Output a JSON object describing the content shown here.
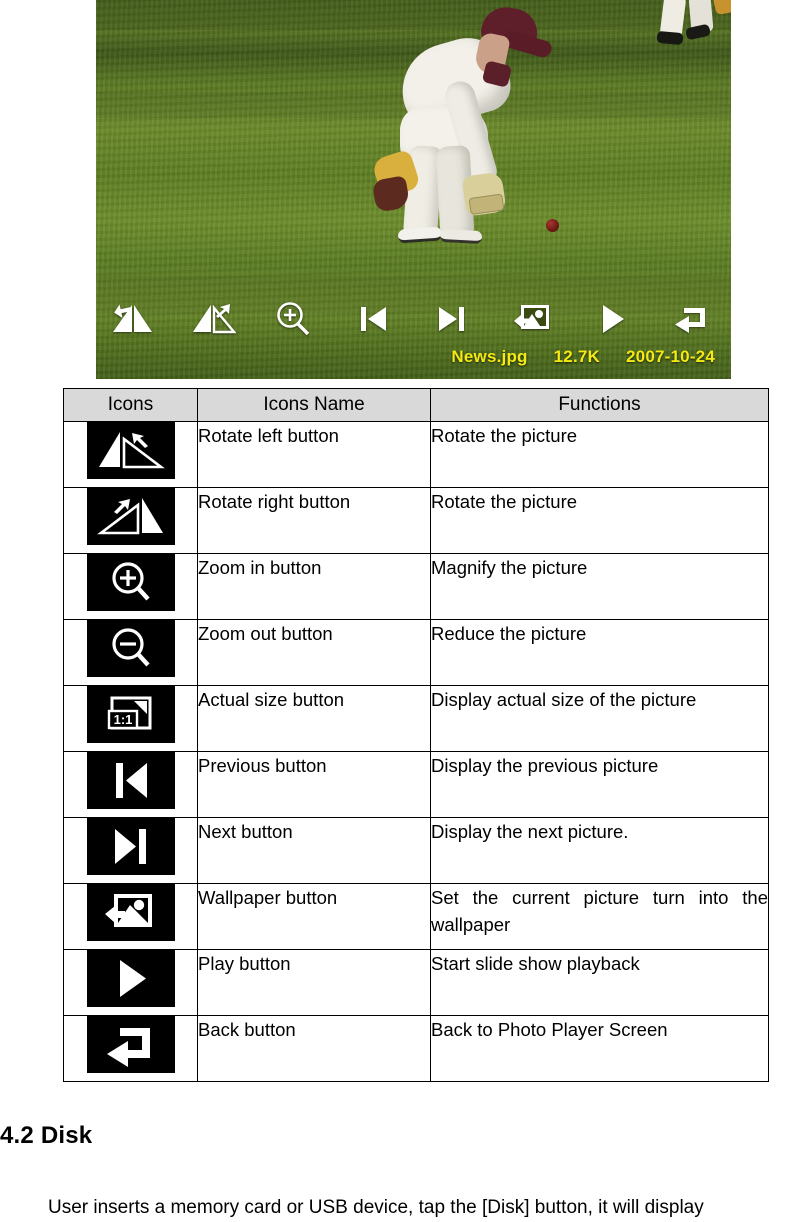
{
  "photo_viewer": {
    "alt": "Cricket fielder in white kit bending to field a red ball on a green outfield",
    "toolbar_buttons": [
      {
        "name": "rotate-left-icon",
        "label": "Rotate left button"
      },
      {
        "name": "rotate-right-icon",
        "label": "Rotate right button"
      },
      {
        "name": "zoom-in-icon",
        "label": "Zoom in button"
      },
      {
        "name": "previous-icon",
        "label": "Previous button"
      },
      {
        "name": "next-icon",
        "label": "Next button"
      },
      {
        "name": "wallpaper-icon",
        "label": "Wallpaper button"
      },
      {
        "name": "play-icon",
        "label": "Play button"
      },
      {
        "name": "back-icon",
        "label": "Back button"
      }
    ],
    "status": {
      "filename": "News.jpg",
      "filesize": "12.7K",
      "date": "2007-10-24",
      "text_color": "#f5ea13"
    }
  },
  "table": {
    "headers": [
      "Icons",
      "Icons Name",
      "Functions"
    ],
    "header_bg": "#d9d9d9",
    "rows": [
      {
        "icon": "rotate-left-icon",
        "name": "Rotate left button",
        "function": "Rotate the picture"
      },
      {
        "icon": "rotate-right-icon",
        "name": "Rotate right button",
        "function": "Rotate the picture"
      },
      {
        "icon": "zoom-in-icon",
        "name": "Zoom in button",
        "function": "Magnify the picture"
      },
      {
        "icon": "zoom-out-icon",
        "name": "Zoom out button",
        "function": "Reduce the picture"
      },
      {
        "icon": "actual-size-icon",
        "name": "Actual size button",
        "function": "Display actual size of the picture"
      },
      {
        "icon": "previous-icon",
        "name": "Previous button",
        "function": "Display the previous picture"
      },
      {
        "icon": "next-icon",
        "name": "Next button",
        "function": "Display the next picture."
      },
      {
        "icon": "wallpaper-icon",
        "name": "Wallpaper button",
        "function": "Set the current picture turn into the wallpaper"
      },
      {
        "icon": "play-icon",
        "name": "Play button",
        "function": "Start slide show playback"
      },
      {
        "icon": "back-icon",
        "name": "Back button",
        "function": "Back to Photo Player Screen"
      }
    ]
  },
  "section": {
    "heading": "4.2 Disk",
    "paragraph": "User inserts a memory card or USB device, tap the [Disk] button, it will display"
  }
}
